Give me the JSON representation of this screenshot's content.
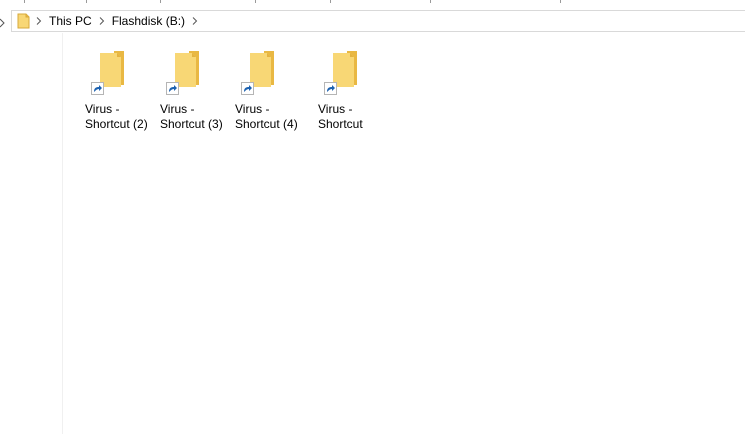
{
  "breadcrumb": {
    "items": [
      {
        "label": "This PC"
      },
      {
        "label": "Flashdisk (B:)"
      }
    ]
  },
  "colors": {
    "folder_back": "#e9b843",
    "folder_front": "#f8d775",
    "shortcut_arrow": "#1c61b0"
  },
  "files": [
    {
      "name_line1": "Virus -",
      "name_line2": "Shortcut (2)"
    },
    {
      "name_line1": "Virus -",
      "name_line2": "Shortcut (3)"
    },
    {
      "name_line1": "Virus -",
      "name_line2": "Shortcut (4)"
    },
    {
      "name_line1": "Virus -",
      "name_line2": "Shortcut"
    }
  ]
}
